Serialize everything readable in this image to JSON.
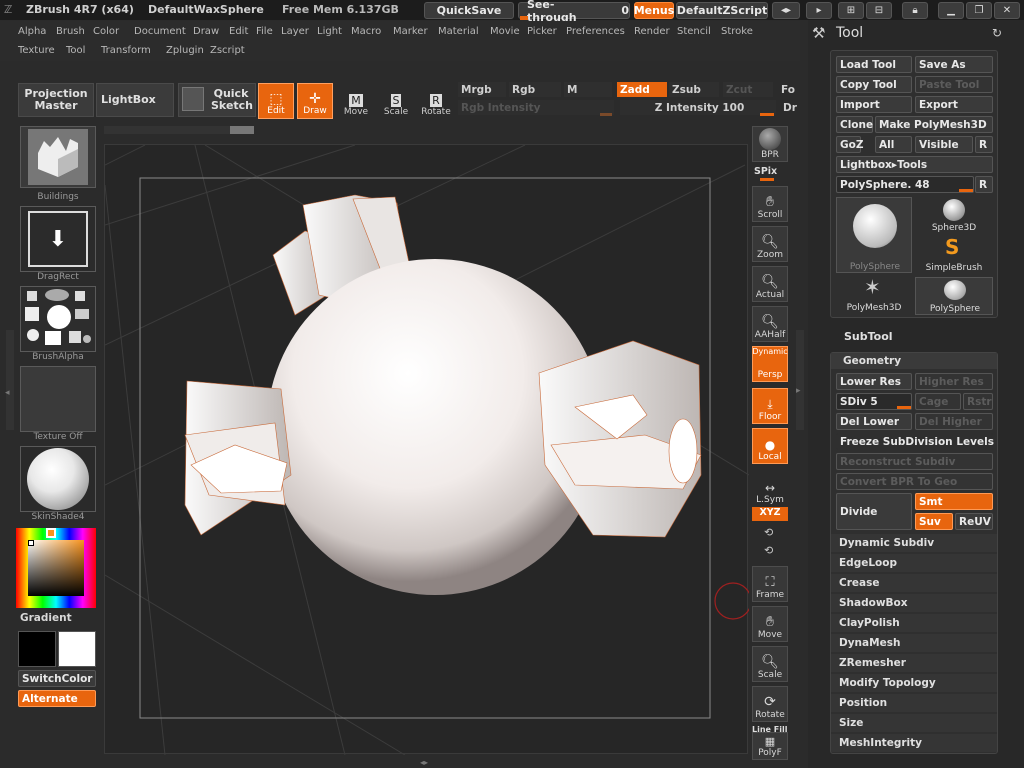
{
  "titlebar": {
    "app": "ZBrush 4R7 (x64)",
    "doc": "DefaultWaxSphere",
    "mem": "Free Mem 6.137GB",
    "quicksave": "QuickSave",
    "seethrough_label": "See-through",
    "seethrough_value": "0",
    "menus": "Menus",
    "script": "DefaultZScript"
  },
  "menus": [
    "Alpha",
    "Brush",
    "Color",
    "Document",
    "Draw",
    "Edit",
    "File",
    "Layer",
    "Light",
    "Macro",
    "Marker",
    "Material",
    "Movie",
    "Picker",
    "Preferences",
    "Render",
    "Stencil",
    "Stroke",
    "Texture",
    "Tool",
    "Transform",
    "Zplugin",
    "Zscript"
  ],
  "toolbar": {
    "projection_master": "Projection Master",
    "lightbox": "LightBox",
    "quick_sketch": "Quick Sketch",
    "edit": "Edit",
    "draw": "Draw",
    "move": "Move",
    "scale": "Scale",
    "rotate": "Rotate",
    "mrgb": "Mrgb",
    "rgb": "Rgb",
    "m": "M",
    "zadd": "Zadd",
    "zsub": "Zsub",
    "zcut": "Zcut",
    "rgb_intensity": "Rgb Intensity",
    "z_intensity": "Z Intensity 100",
    "fo": "Fo",
    "dr": "Dr"
  },
  "left": {
    "buildings": "Buildings",
    "dragrect": "DragRect",
    "brushalpha": "BrushAlpha",
    "texture_off": "Texture Off",
    "skinshade": "SkinShade4",
    "gradient": "Gradient",
    "switchcolor": "SwitchColor",
    "alternate": "Alternate"
  },
  "right_shelf": {
    "bpr": "BPR",
    "spix": "SPix",
    "scroll": "Scroll",
    "zoom": "Zoom",
    "actual": "Actual",
    "aahalf": "AAHalf",
    "dynamic": "Dynamic",
    "persp": "Persp",
    "floor": "Floor",
    "local": "Local",
    "lsym": "L.Sym",
    "xyz": "XYZ",
    "frame": "Frame",
    "move": "Move",
    "scale": "Scale",
    "rotate": "Rotate",
    "line_fill": "Line Fill",
    "polyf": "PolyF"
  },
  "tool_panel": {
    "title": "Tool",
    "load_tool": "Load Tool",
    "save_as": "Save As",
    "copy_tool": "Copy Tool",
    "paste_tool": "Paste Tool",
    "import": "Import",
    "export": "Export",
    "clone": "Clone",
    "make_polymesh": "Make PolyMesh3D",
    "goz": "GoZ",
    "all": "All",
    "visible": "Visible",
    "r": "R",
    "lightbox_tools": "Lightbox▸Tools",
    "polysphere_slider": "PolySphere. 48",
    "thumbs": [
      "PolySphere",
      "Sphere3D",
      "SimpleBrush",
      "PolyMesh3D",
      "PolySphere"
    ]
  },
  "subtool": "SubTool",
  "geometry": {
    "title": "Geometry",
    "lower_res": "Lower Res",
    "higher_res": "Higher Res",
    "sdiv": "SDiv 5",
    "cage": "Cage",
    "rstr": "Rstr",
    "del_lower": "Del Lower",
    "del_higher": "Del Higher",
    "freeze": "Freeze SubDivision Levels",
    "reconstruct": "Reconstruct Subdiv",
    "convert_bpr": "Convert BPR To Geo",
    "divide": "Divide",
    "smt": "Smt",
    "suv": "Suv",
    "reuv": "ReUV",
    "items": [
      "Dynamic Subdiv",
      "EdgeLoop",
      "Crease",
      "ShadowBox",
      "ClayPolish",
      "DynaMesh",
      "ZRemesher",
      "Modify Topology",
      "Position",
      "Size",
      "MeshIntegrity"
    ]
  },
  "colors": {
    "accent": "#e8650e"
  }
}
